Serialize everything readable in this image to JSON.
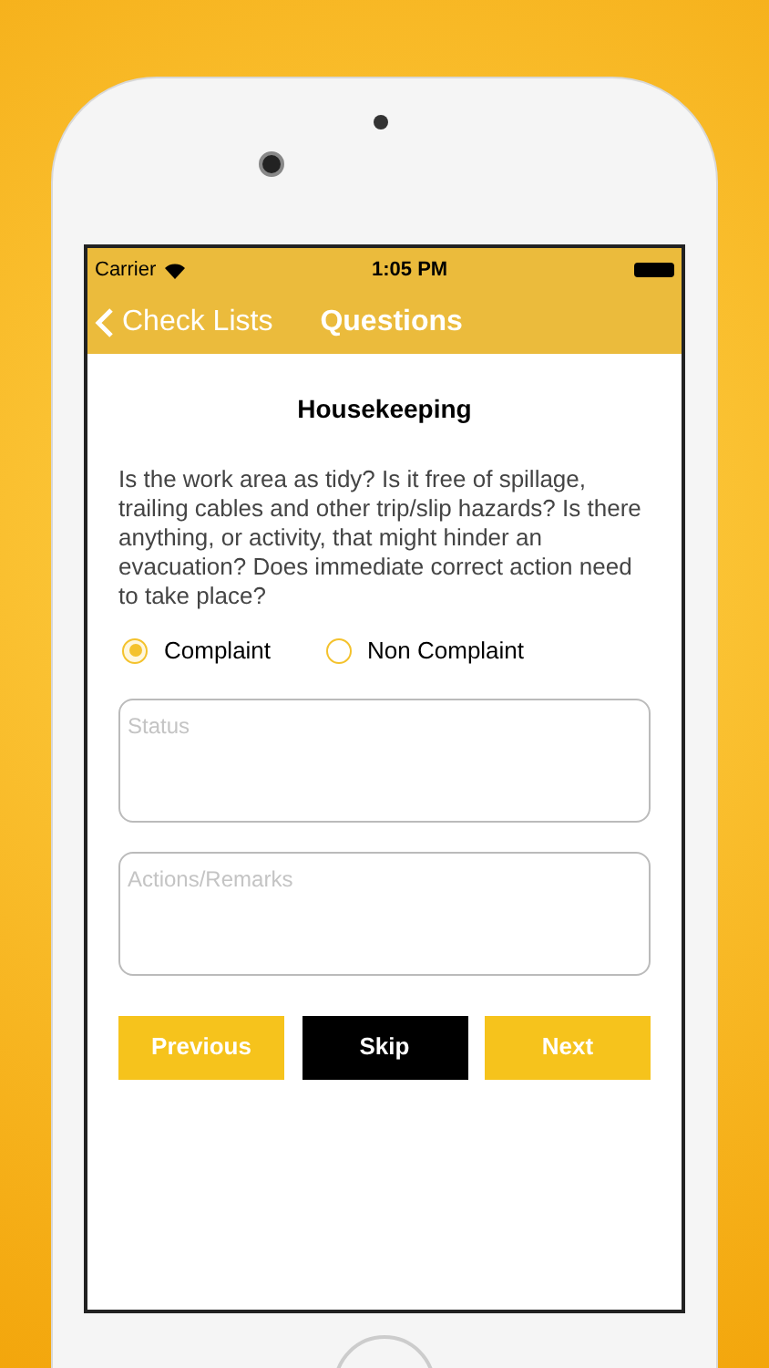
{
  "status_bar": {
    "carrier": "Carrier",
    "time": "1:05 PM"
  },
  "nav_bar": {
    "back": "Check Lists",
    "title": "Questions"
  },
  "question": {
    "title": "Housekeeping",
    "text": "Is the work area as tidy? Is it free of spillage, trailing cables and other trip/slip hazards? Is there anything, or activity, that might hinder an evacuation? Does immediate correct action need to take place?"
  },
  "options": [
    {
      "label": "Complaint",
      "selected": true
    },
    {
      "label": "Non Complaint",
      "selected": false
    }
  ],
  "fields": [
    {
      "placeholder": "Status"
    },
    {
      "placeholder": "Actions/Remarks"
    }
  ],
  "buttons": [
    {
      "label": "Previous",
      "kind": "primary"
    },
    {
      "label": "Skip",
      "kind": "dark"
    },
    {
      "label": "Next",
      "kind": "primary"
    }
  ]
}
